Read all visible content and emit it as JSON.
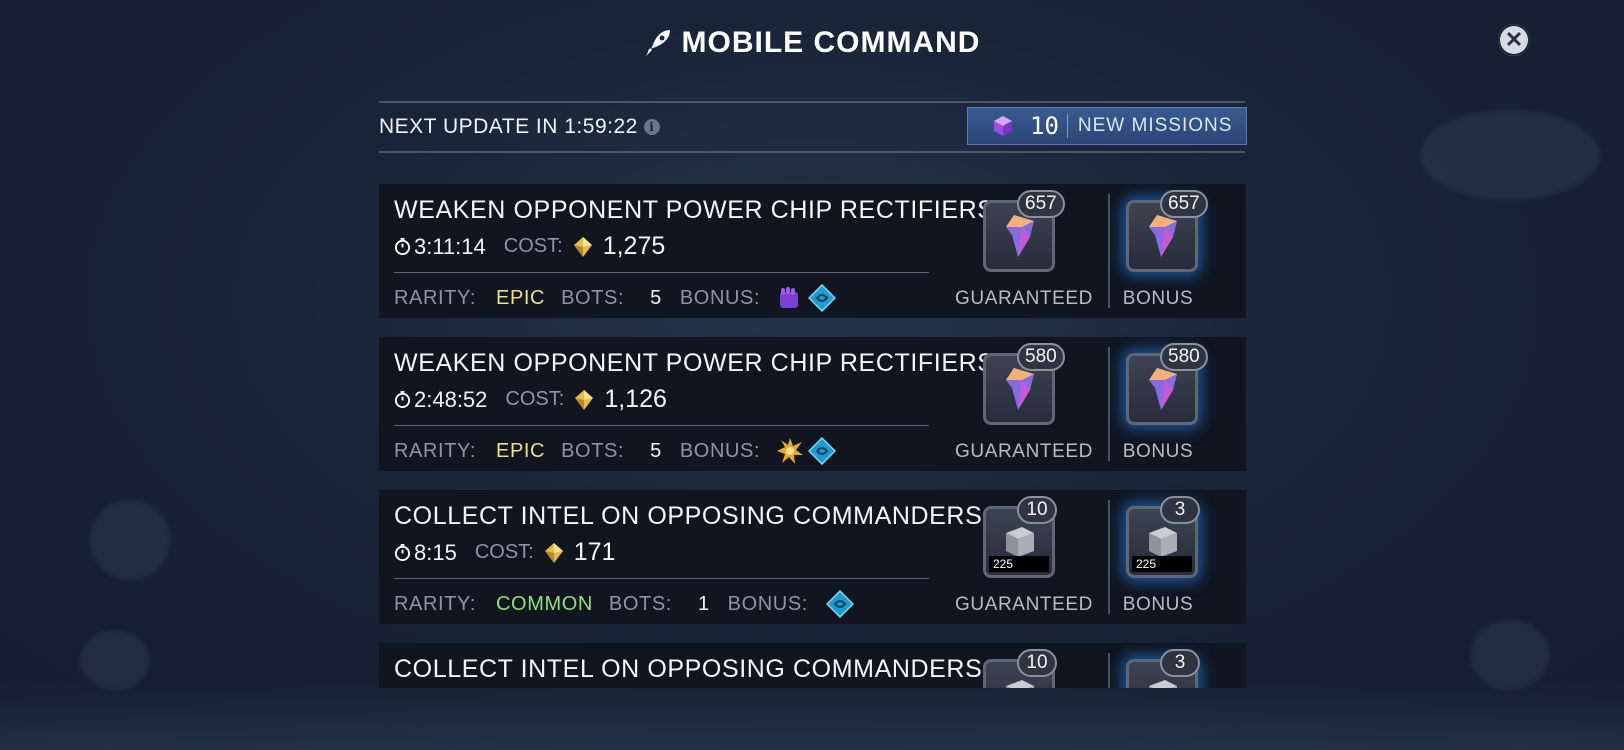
{
  "header": {
    "title": "MOBILE COMMAND",
    "close_label": "✕"
  },
  "status": {
    "next_update": "NEXT UPDATE IN 1:59:22",
    "info_icon": "i"
  },
  "missions_button": {
    "count": "10",
    "label": "NEW MISSIONS"
  },
  "labels": {
    "cost": "COST:",
    "rarity": "RARITY:",
    "bots": "BOTS:",
    "bonus": "BONUS:",
    "guaranteed": "GUARANTEED",
    "bonus_reward": "BONUS"
  },
  "missions": [
    {
      "title": "WEAKEN OPPONENT POWER CHIP RECTIFIERS",
      "time": "3:11:14",
      "cost": "1,275",
      "rarity": "EPIC",
      "bots": "5",
      "guaranteed_count": "657",
      "bonus_count": "657",
      "reward_type": "chip",
      "bonus_icons": [
        "fist-icon",
        "circuit-icon"
      ]
    },
    {
      "title": "WEAKEN OPPONENT POWER CHIP RECTIFIERS",
      "time": "2:48:52",
      "cost": "1,126",
      "rarity": "EPIC",
      "bots": "5",
      "guaranteed_count": "580",
      "bonus_count": "580",
      "reward_type": "chip",
      "bonus_icons": [
        "burst-icon",
        "circuit-icon"
      ]
    },
    {
      "title": "COLLECT INTEL ON OPPOSING COMMANDERS",
      "time": "8:15",
      "cost": "171",
      "rarity": "COMMON",
      "bots": "1",
      "guaranteed_count": "10",
      "bonus_count": "3",
      "reward_strip": "225",
      "reward_type": "crate",
      "bonus_icons": [
        "circuit-icon"
      ]
    },
    {
      "title": "COLLECT INTEL ON OPPOSING COMMANDERS",
      "guaranteed_count": "10",
      "bonus_count": "3",
      "reward_type": "crate"
    }
  ],
  "colors": {
    "epic": "#e8e08a",
    "common": "#8fe07a",
    "accent_button": "#2b4677"
  }
}
